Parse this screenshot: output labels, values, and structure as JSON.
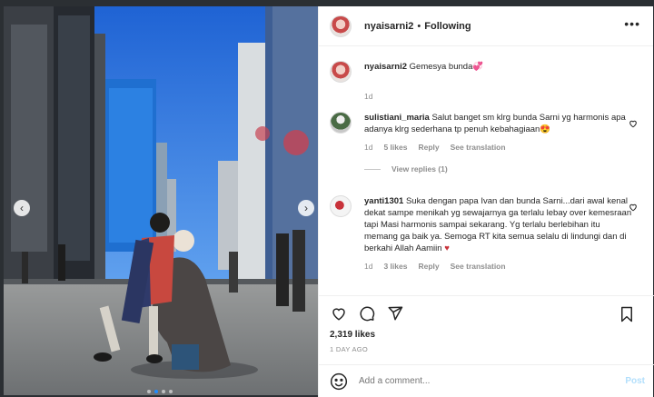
{
  "post": {
    "username": "nyaisarni2",
    "bullet": "•",
    "following": "Following",
    "more": "•••",
    "caption": "Gemesya bunda",
    "caption_emoji": "💞",
    "caption_age": "1d"
  },
  "comments": [
    {
      "username": "sulistiani_maria",
      "text": "Salut banget sm klrg bunda Sarni yg harmonis apa adanya klrg sederhana tp penuh kebahagiaan",
      "emoji": "😍",
      "age": "1d",
      "likes": "5 likes",
      "reply": "Reply",
      "translation": "See translation",
      "view_replies": "View replies (1)"
    },
    {
      "username": "yanti1301",
      "text": "Suka dengan papa Ivan dan bunda Sarni...dari awal kenal dekat sampe menikah yg sewajarnya ga terlalu lebay over kemesraan tapi Masi harmonis sampai sekarang. Yg terlalu berlebihan itu memang ga baik ya. Semoga RT kita semua selalu di lindungi dan di berkahi Allah Aamiin",
      "emoji": "♥",
      "age": "1d",
      "likes": "3 likes",
      "reply": "Reply",
      "translation": "See translation"
    }
  ],
  "stats": {
    "likes": "2,319 likes",
    "time_ago": "1 DAY AGO"
  },
  "add_comment": {
    "placeholder": "Add a comment...",
    "post_label": "Post"
  },
  "carousel": {
    "prev": "‹",
    "next": "›",
    "slide_count": 4,
    "active_slide": 2
  },
  "icons": {
    "like": "heart-icon",
    "comment": "comment-icon",
    "share": "paper-plane-icon",
    "save": "bookmark-icon",
    "emoji": "smiley-icon",
    "more": "ellipsis-icon"
  },
  "colors": {
    "accent": "#0095f6",
    "post_disabled": "#b2dffc",
    "muted": "#8e8e8e",
    "heart_red": "#ed4956"
  }
}
